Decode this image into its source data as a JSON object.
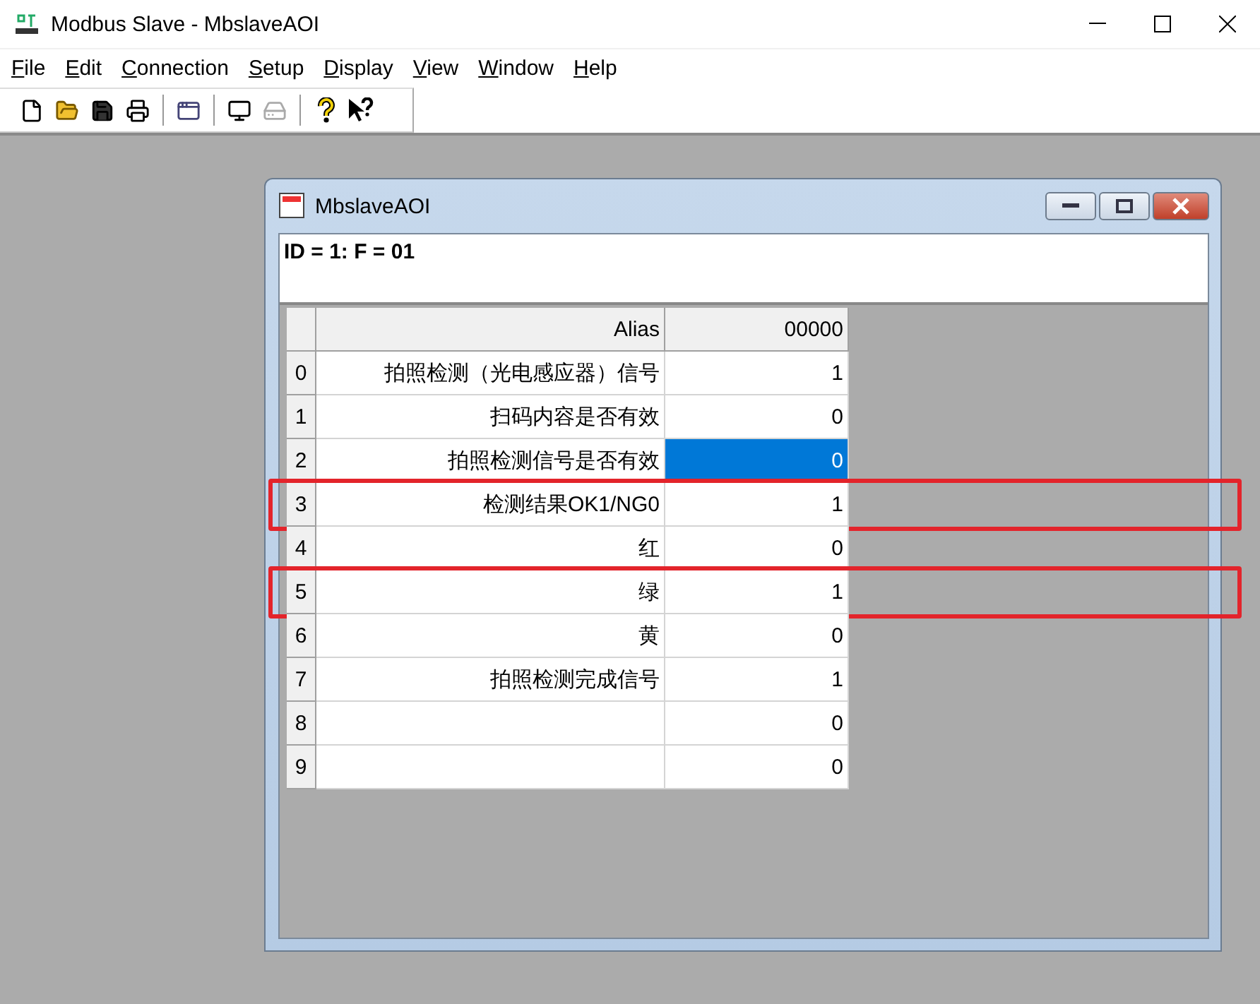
{
  "window": {
    "title": "Modbus Slave - MbslaveAOI"
  },
  "menu": [
    {
      "label": "File"
    },
    {
      "label": "Edit"
    },
    {
      "label": "Connection"
    },
    {
      "label": "Setup"
    },
    {
      "label": "Display"
    },
    {
      "label": "View"
    },
    {
      "label": "Window"
    },
    {
      "label": "Help"
    }
  ],
  "toolbar": [
    {
      "kind": "new"
    },
    {
      "kind": "open"
    },
    {
      "kind": "save"
    },
    {
      "kind": "print"
    },
    {
      "kind": "sep"
    },
    {
      "kind": "window"
    },
    {
      "kind": "sep"
    },
    {
      "kind": "connect",
      "disabled": false
    },
    {
      "kind": "disconnect",
      "disabled": true
    },
    {
      "kind": "sep"
    },
    {
      "kind": "about"
    },
    {
      "kind": "context-help"
    }
  ],
  "document": {
    "title": "MbslaveAOI",
    "info": "ID = 1: F = 01",
    "table": {
      "columns": [
        "Alias",
        "00000"
      ],
      "rows": [
        {
          "index": "0",
          "alias": "拍照检测（光电感应器）信号",
          "value": "1",
          "selected": false,
          "highlighted": false
        },
        {
          "index": "1",
          "alias": "扫码内容是否有效",
          "value": "0",
          "selected": false,
          "highlighted": false
        },
        {
          "index": "2",
          "alias": "拍照检测信号是否有效",
          "value": "0",
          "selected": true,
          "highlighted": false
        },
        {
          "index": "3",
          "alias": "检测结果OK1/NG0",
          "value": "1",
          "selected": false,
          "highlighted": true
        },
        {
          "index": "4",
          "alias": "红",
          "value": "0",
          "selected": false,
          "highlighted": false
        },
        {
          "index": "5",
          "alias": "绿",
          "value": "1",
          "selected": false,
          "highlighted": true
        },
        {
          "index": "6",
          "alias": "黄",
          "value": "0",
          "selected": false,
          "highlighted": false
        },
        {
          "index": "7",
          "alias": "拍照检测完成信号",
          "value": "1",
          "selected": false,
          "highlighted": false
        },
        {
          "index": "8",
          "value": "0",
          "selected": false,
          "highlighted": false
        },
        {
          "index": "9",
          "value": "0",
          "selected": false,
          "highlighted": false
        }
      ]
    }
  }
}
